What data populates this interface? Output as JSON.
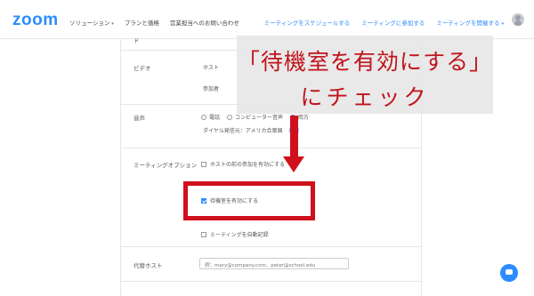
{
  "brand": "zoom",
  "nav": {
    "left": [
      {
        "label": "ソリューション",
        "caret": "▾"
      },
      {
        "label": "プランと価格",
        "caret": ""
      },
      {
        "label": "営業担当へのお問い合わせ",
        "caret": ""
      }
    ],
    "right": [
      {
        "label": "ミーティングをスケジュールする",
        "caret": ""
      },
      {
        "label": "ミーティングに参加する",
        "caret": ""
      },
      {
        "label": "ミーティングを開催する",
        "caret": "▾"
      }
    ]
  },
  "settings": {
    "top_partial": "ド",
    "video": {
      "label": "ビデオ",
      "host_label": "ホスト",
      "participant_label": "参加者"
    },
    "audio": {
      "label": "音声",
      "options": [
        "電話",
        "コンピューター音声",
        "両方"
      ],
      "selected": "両方",
      "dialin_label": "ダイヤル発信元：アメリカ合衆国",
      "edit_link": "編集"
    },
    "meeting_options": {
      "label": "ミーティングオプション",
      "items": [
        {
          "label": "ホストの前の参加を有効にする",
          "checked": false
        },
        {
          "label": "待機室を有効にする",
          "checked": true
        },
        {
          "label": "ミーティングを自動記録",
          "checked": false
        }
      ]
    },
    "alt_host": {
      "label": "代替ホスト",
      "placeholder": "例：mary@company.com、peter@school.edu"
    }
  },
  "overlay": {
    "line1": "「待機室を有効にする」",
    "line2": "にチェック"
  },
  "colors": {
    "brand_blue": "#2d8cff",
    "annotation_red": "#d0101c"
  },
  "icons": {
    "avatar": "user-avatar-icon",
    "chat": "chat-bubble-icon"
  }
}
